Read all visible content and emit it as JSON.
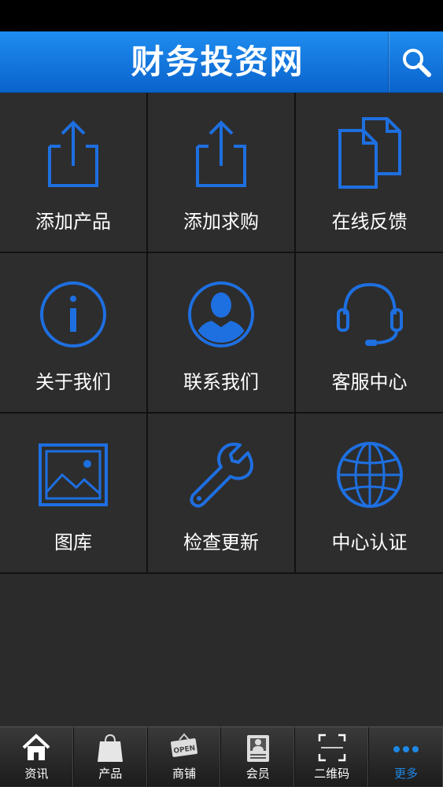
{
  "header": {
    "title": "财务投资网"
  },
  "grid": {
    "items": [
      {
        "label": "添加产品",
        "icon": "share-icon"
      },
      {
        "label": "添加求购",
        "icon": "share-icon"
      },
      {
        "label": "在线反馈",
        "icon": "documents-icon"
      },
      {
        "label": "关于我们",
        "icon": "info-icon"
      },
      {
        "label": "联系我们",
        "icon": "user-icon"
      },
      {
        "label": "客服中心",
        "icon": "headset-icon"
      },
      {
        "label": "图库",
        "icon": "image-icon"
      },
      {
        "label": "检查更新",
        "icon": "wrench-icon"
      },
      {
        "label": "中心认证",
        "icon": "globe-icon"
      }
    ]
  },
  "tabbar": {
    "items": [
      {
        "label": "资讯",
        "icon": "home-icon"
      },
      {
        "label": "产品",
        "icon": "bag-icon"
      },
      {
        "label": "商铺",
        "icon": "open-sign-icon"
      },
      {
        "label": "会员",
        "icon": "id-card-icon"
      },
      {
        "label": "二维码",
        "icon": "qr-scan-icon"
      },
      {
        "label": "更多",
        "icon": "more-icon"
      }
    ],
    "active_index": 5
  },
  "colors": {
    "accent": "#1e6fe0",
    "header": "#1a7fe6",
    "background": "#2b2b2b"
  }
}
